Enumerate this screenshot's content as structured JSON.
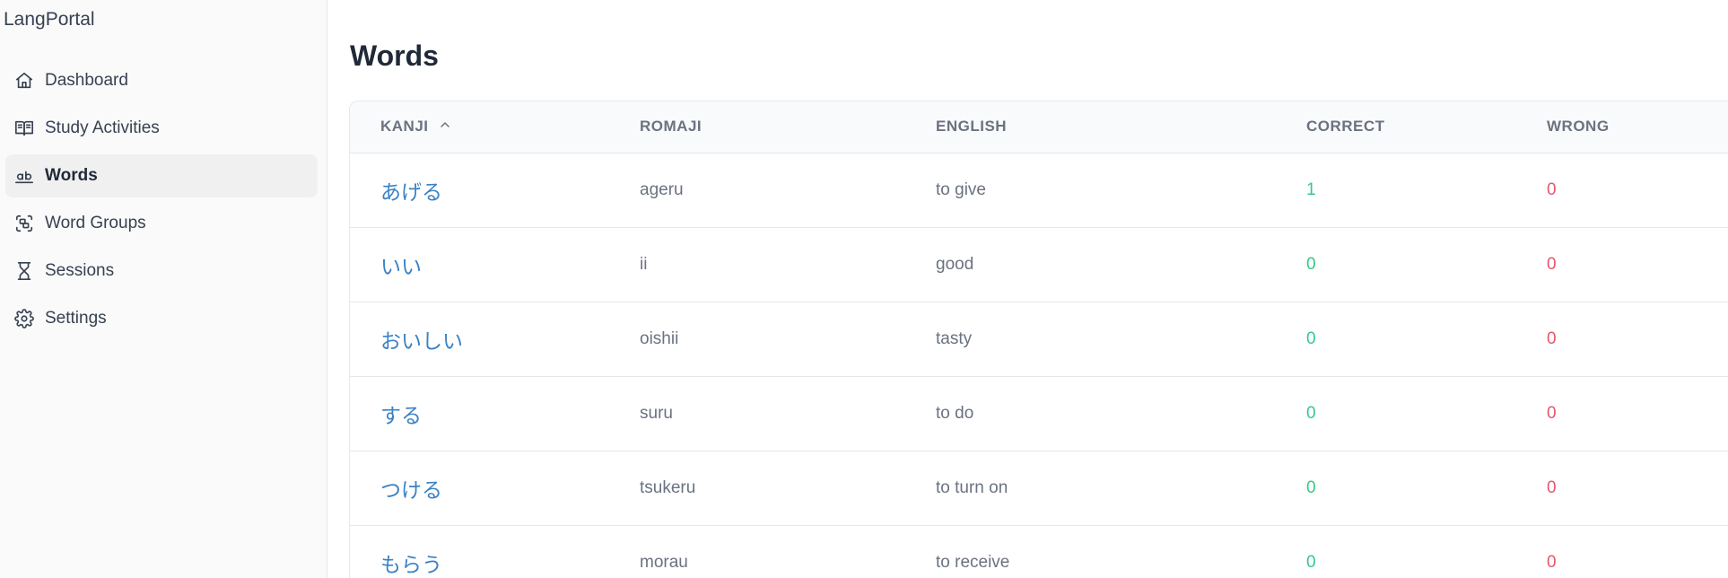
{
  "app": {
    "brand": "LangPortal"
  },
  "sidebar": {
    "items": [
      {
        "label": "Dashboard",
        "icon": "home-icon",
        "active": false
      },
      {
        "label": "Study Activities",
        "icon": "book-open-icon",
        "active": false
      },
      {
        "label": "Words",
        "icon": "words-icon",
        "active": true
      },
      {
        "label": "Word Groups",
        "icon": "group-icon",
        "active": false
      },
      {
        "label": "Sessions",
        "icon": "hourglass-icon",
        "active": false
      },
      {
        "label": "Settings",
        "icon": "gear-icon",
        "active": false
      }
    ]
  },
  "main": {
    "title": "Words",
    "table": {
      "columns": {
        "kanji": "KANJI",
        "romaji": "ROMAJI",
        "english": "ENGLISH",
        "correct": "CORRECT",
        "wrong": "WRONG"
      },
      "sort": {
        "column": "kanji",
        "direction": "ascending"
      },
      "rows": [
        {
          "kanji": "あげる",
          "romaji": "ageru",
          "english": "to give",
          "correct": "1",
          "wrong": "0"
        },
        {
          "kanji": "いい",
          "romaji": "ii",
          "english": "good",
          "correct": "0",
          "wrong": "0"
        },
        {
          "kanji": "おいしい",
          "romaji": "oishii",
          "english": "tasty",
          "correct": "0",
          "wrong": "0"
        },
        {
          "kanji": "する",
          "romaji": "suru",
          "english": "to do",
          "correct": "0",
          "wrong": "0"
        },
        {
          "kanji": "つける",
          "romaji": "tsukeru",
          "english": "to turn on",
          "correct": "0",
          "wrong": "0"
        },
        {
          "kanji": "もらう",
          "romaji": "morau",
          "english": "to receive",
          "correct": "0",
          "wrong": "0"
        }
      ]
    }
  },
  "colors": {
    "link": "#3b82c4",
    "correct": "#34c98a",
    "wrong": "#e5566d",
    "sidebar_bg": "#fafafa",
    "active_bg": "#f0f0f1"
  }
}
